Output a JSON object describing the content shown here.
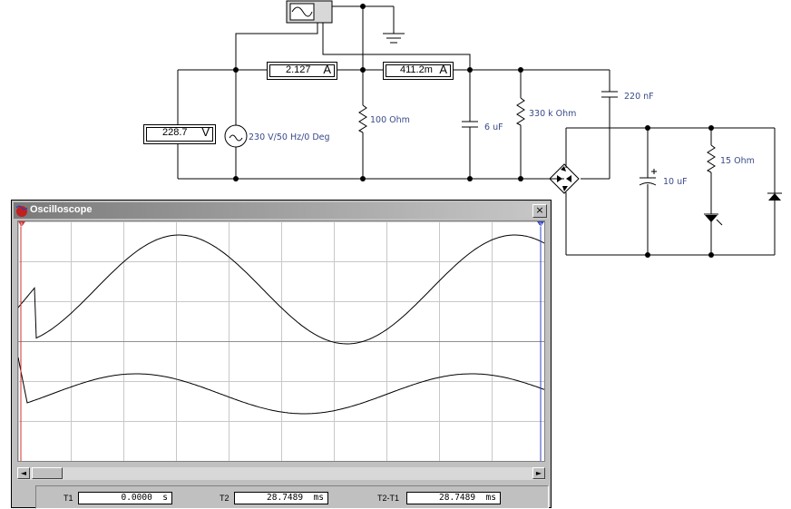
{
  "circuit": {
    "voltmeter": {
      "value": "228.7",
      "unit": "V"
    },
    "ammeter_1": {
      "value": "2.127",
      "unit": "A"
    },
    "ammeter_2": {
      "value": "411.2m",
      "unit": "A"
    },
    "source_label": "230 V/50 Hz/0 Deg",
    "resistor_100": "100  Ohm",
    "cap_6uf": "6 uF",
    "resistor_330k": "330 k Ohm",
    "cap_220nf": "220 nF",
    "cap_10uf": "10 uF",
    "resistor_15": "15  Ohm"
  },
  "oscilloscope": {
    "title": "Oscilloscope",
    "close_glyph": "×",
    "cursor1_label": "1",
    "cursor2_label": "2",
    "scroll_left": "◄",
    "scroll_right": "►",
    "readout": {
      "t1_label": "T1",
      "t1_value": "0.0000",
      "t1_unit": "s",
      "t2_label": "T2",
      "t2_value": "28.7489",
      "t2_unit": "ms",
      "dt_label": "T2-T1",
      "dt_value": "28.7489",
      "dt_unit": "ms"
    },
    "trace_color": "#000000",
    "grid_color": "#c8c8c8",
    "cursor1_color": "#d03030",
    "cursor2_color": "#3040c0"
  }
}
